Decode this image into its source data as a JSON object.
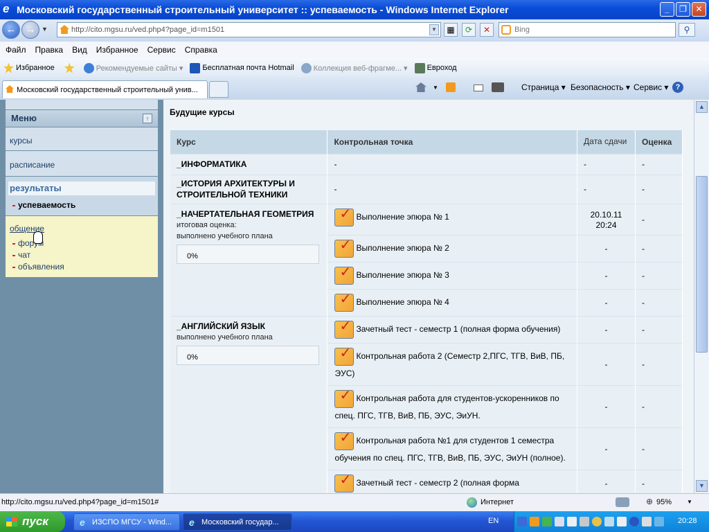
{
  "window": {
    "title": "Московский государственный строительный университет :: успеваемость - Windows Internet Explorer"
  },
  "address": {
    "url": "http://cito.mgsu.ru/ved.php4?page_id=m1501"
  },
  "search": {
    "placeholder": "Bing"
  },
  "menu": [
    "Файл",
    "Правка",
    "Вид",
    "Избранное",
    "Сервис",
    "Справка"
  ],
  "favorites": {
    "label": "Избранное",
    "items": [
      "Рекомендуемые сайты ▾",
      "Бесплатная почта Hotmail",
      "Коллекция веб-фрагме... ▾",
      "Евроход"
    ]
  },
  "tab": {
    "title": "Московский государственный строительный унив..."
  },
  "commands": [
    "Страница ▾",
    "Безопасность ▾",
    "Сервис ▾"
  ],
  "sidebar": {
    "menu_title": "Меню",
    "toggle": "↑",
    "items": [
      "курсы",
      "расписание"
    ],
    "results": "результаты",
    "results_sub": "успеваемость",
    "communication": "общение",
    "comm_subs": [
      "форум",
      "чат",
      "объявления"
    ]
  },
  "main": {
    "title": "Будущие курсы",
    "headers": [
      "Курс",
      "Контрольная точка",
      "Дата сдачи",
      "Оценка"
    ],
    "rows": [
      {
        "course": "_ИНФОРМАТИКА",
        "kp": "-",
        "date": "-",
        "grade": "-"
      },
      {
        "course": "_ИСТОРИЯ АРХИТЕКТУРЫ И СТРОИТЕЛЬНОЙ ТЕХНИКИ",
        "kp": "-",
        "date": "-",
        "grade": "-"
      }
    ],
    "geometry": {
      "course": "_НАЧЕРТАТЕЛЬНАЯ ГЕОМЕТРИЯ",
      "note1": "итоговая оценка:",
      "note2": "выполнено учебного плана",
      "pct": "0%",
      "kps": [
        {
          "label": "Выполнение эпюра № 1",
          "date": "20.10.11 20:24",
          "grade": "-"
        },
        {
          "label": "Выполнение эпюра № 2",
          "date": "-",
          "grade": "-"
        },
        {
          "label": "Выполнение эпюра № 3",
          "date": "-",
          "grade": "-"
        },
        {
          "label": "Выполнение эпюра № 4",
          "date": "-",
          "grade": "-"
        }
      ]
    },
    "english": {
      "course": "_АНГЛИЙСКИЙ ЯЗЫК",
      "note": "выполнено учебного плана",
      "pct": "0%",
      "kps": [
        {
          "label": "Зачетный тест - семестр 1 (полная форма обучения)",
          "date": "-",
          "grade": "-"
        },
        {
          "label": "Контрольная работа 2 (Семестр 2,ПГС, ТГВ, ВиВ, ПБ, ЭУС)",
          "date": "-",
          "grade": "-"
        },
        {
          "label": "Контрольная работа для студентов-ускоренников по спец. ПГС, ТГВ, ВиВ, ПБ, ЭУС, ЭиУН.",
          "date": "-",
          "grade": "-"
        },
        {
          "label": "Контрольная работа №1 для студентов 1 семестра обучения по спец. ПГС, ТГВ, ВиВ, ПБ, ЭУС, ЭиУН (полное).",
          "date": "-",
          "grade": "-"
        },
        {
          "label": "Зачетный тест - семестр 2 (полная форма",
          "date": "-",
          "grade": "-"
        }
      ]
    }
  },
  "status": {
    "url": "http://cito.mgsu.ru/ved.php4?page_id=m1501#",
    "zone": "Интернет",
    "zoom": "95%"
  },
  "taskbar": {
    "start": "пуск",
    "tasks": [
      "ИЗСПО МГСУ - Wind...",
      "Московский государ..."
    ],
    "lang": "EN",
    "time": "20:28"
  }
}
